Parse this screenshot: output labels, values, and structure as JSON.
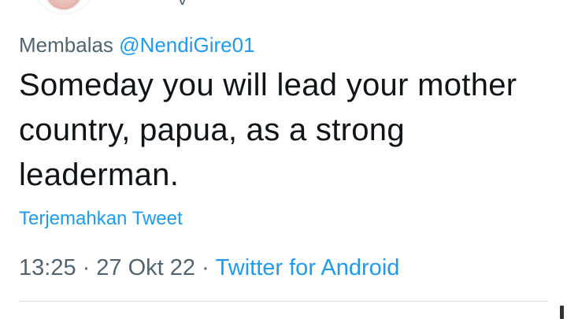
{
  "tweet": {
    "reply_prefix": "Membalas",
    "reply_handle": "@NendiGire01",
    "text": "Someday you will lead your mother country, papua, as a strong leaderman.",
    "translate_label": "Terjemahkan Tweet",
    "time": "13:25",
    "date": "27 Okt 22",
    "source": "Twitter for Android",
    "separator": "·"
  },
  "colors": {
    "link": "#1d9bf0",
    "secondary_text": "#536471",
    "primary_text": "#0f1419",
    "divider": "#cfd9de"
  }
}
